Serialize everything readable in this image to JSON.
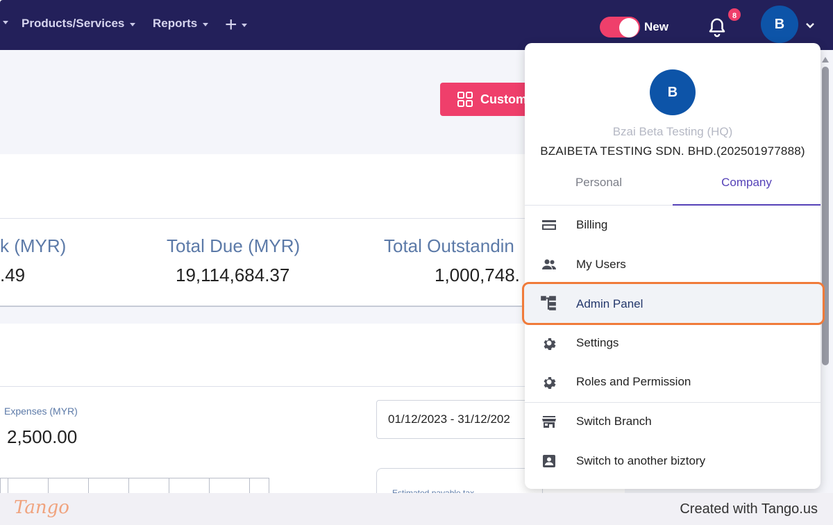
{
  "topnav": {
    "items": [
      {
        "label": "Products/Services"
      },
      {
        "label": "Reports"
      }
    ],
    "toggle_label": "New",
    "notification_count": "8",
    "avatar_initial": "B",
    "colors": {
      "bg": "#23205a",
      "accent": "#ef3f6b"
    }
  },
  "content": {
    "customize_button": "Custom",
    "stats": [
      {
        "label": "k (MYR)",
        "value": ".49"
      },
      {
        "label": "Total Due (MYR)",
        "value": "19,114,684.37"
      },
      {
        "label": "Total Outstandin",
        "value": "1,000,748."
      }
    ],
    "expenses_label": "Expenses (MYR)",
    "expenses_value": "2,500.00",
    "date_range": "01/12/2023 - 31/12/202",
    "tax_card_label": "Estimated payable tax"
  },
  "dropdown": {
    "avatar_initial": "B",
    "company_name": "Bzai Beta Testing (HQ)",
    "legal_name": "BZAIBETA TESTING SDN. BHD.(202501977888)",
    "tabs": [
      {
        "label": "Personal",
        "active": false
      },
      {
        "label": "Company",
        "active": true
      }
    ],
    "items": [
      {
        "label": "Billing",
        "icon": "credit-card-icon"
      },
      {
        "label": "My Users",
        "icon": "users-icon"
      },
      {
        "label": "Admin Panel",
        "icon": "admin-panel-icon",
        "highlighted": true
      },
      {
        "label": "Settings",
        "icon": "gear-icon"
      },
      {
        "label": "Roles and Permission",
        "icon": "gear-icon"
      },
      {
        "label": "Switch Branch",
        "icon": "store-icon"
      },
      {
        "label": "Switch to another biztory",
        "icon": "account-box-icon"
      }
    ]
  },
  "footer": {
    "logo": "Tango",
    "text": "Created with Tango.us"
  }
}
